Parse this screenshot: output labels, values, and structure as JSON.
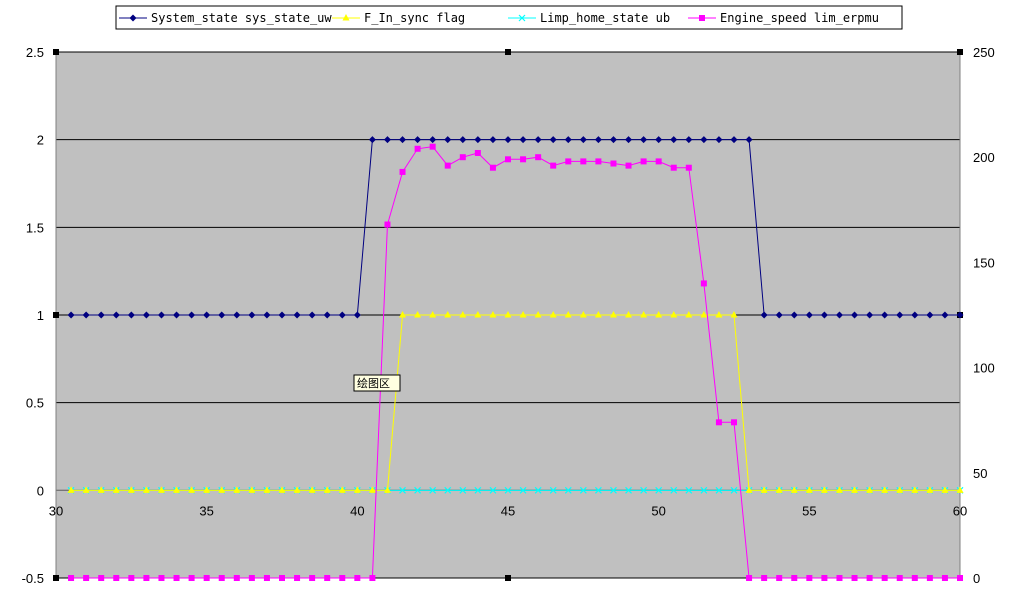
{
  "chart_data": {
    "type": "line",
    "x": [
      30.5,
      31,
      31.5,
      32,
      32.5,
      33,
      33.5,
      34,
      34.5,
      35,
      35.5,
      36,
      36.5,
      37,
      37.5,
      38,
      38.5,
      39,
      39.5,
      40,
      40.5,
      41,
      41.5,
      42,
      42.5,
      43,
      43.5,
      44,
      44.5,
      45,
      45.5,
      46,
      46.5,
      47,
      47.5,
      48,
      48.5,
      49,
      49.5,
      50,
      50.5,
      51,
      51.5,
      52,
      52.5,
      53,
      53.5,
      54,
      54.5,
      55,
      55.5,
      56,
      56.5,
      57,
      57.5,
      58,
      58.5,
      59,
      59.5,
      60
    ],
    "x_range": [
      30,
      60
    ],
    "x_ticks": [
      30,
      35,
      40,
      45,
      50,
      55,
      60
    ],
    "x_tick_labels": [
      "30",
      "35",
      "40",
      "45",
      "50",
      "55",
      "60"
    ],
    "y_left_range": [
      -0.5,
      2.5
    ],
    "y_left_ticks": [
      -0.5,
      0,
      0.5,
      1,
      1.5,
      2,
      2.5
    ],
    "y_left_tick_labels": [
      "-0.5",
      "0",
      "0.5",
      "1",
      "1.5",
      "2",
      "2.5"
    ],
    "y_right_range": [
      0,
      250
    ],
    "y_right_ticks": [
      0,
      50,
      100,
      150,
      200,
      250
    ],
    "y_right_tick_labels": [
      "0",
      "50",
      "100",
      "150",
      "200",
      "250"
    ],
    "gridlines": [
      -0.5,
      0,
      0.5,
      1,
      1.5,
      2,
      2.5
    ],
    "grid": true,
    "legend_position": "top",
    "plot_background": "#c0c0c0",
    "series": [
      {
        "name": "System_state sys_state_uw",
        "color": "#000080",
        "marker": "diamond",
        "axis": "left",
        "values": [
          1,
          1,
          1,
          1,
          1,
          1,
          1,
          1,
          1,
          1,
          1,
          1,
          1,
          1,
          1,
          1,
          1,
          1,
          1,
          1,
          2,
          2,
          2,
          2,
          2,
          2,
          2,
          2,
          2,
          2,
          2,
          2,
          2,
          2,
          2,
          2,
          2,
          2,
          2,
          2,
          2,
          2,
          2,
          2,
          2,
          2,
          1,
          1,
          1,
          1,
          1,
          1,
          1,
          1,
          1,
          1,
          1,
          1,
          1,
          1
        ]
      },
      {
        "name": "F_In_sync flag",
        "color": "#ffff00",
        "marker": "triangle",
        "axis": "left",
        "values": [
          0,
          0,
          0,
          0,
          0,
          0,
          0,
          0,
          0,
          0,
          0,
          0,
          0,
          0,
          0,
          0,
          0,
          0,
          0,
          0,
          0,
          0,
          1,
          1,
          1,
          1,
          1,
          1,
          1,
          1,
          1,
          1,
          1,
          1,
          1,
          1,
          1,
          1,
          1,
          1,
          1,
          1,
          1,
          1,
          1,
          0,
          0,
          0,
          0,
          0,
          0,
          0,
          0,
          0,
          0,
          0,
          0,
          0,
          0,
          0
        ]
      },
      {
        "name": "Limp_home_state ub",
        "color": "#00ffff",
        "marker": "x",
        "axis": "left",
        "values": [
          0,
          0,
          0,
          0,
          0,
          0,
          0,
          0,
          0,
          0,
          0,
          0,
          0,
          0,
          0,
          0,
          0,
          0,
          0,
          0,
          0,
          0,
          0,
          0,
          0,
          0,
          0,
          0,
          0,
          0,
          0,
          0,
          0,
          0,
          0,
          0,
          0,
          0,
          0,
          0,
          0,
          0,
          0,
          0,
          0,
          0,
          0,
          0,
          0,
          0,
          0,
          0,
          0,
          0,
          0,
          0,
          0,
          0,
          0,
          0
        ]
      },
      {
        "name": "Engine_speed lim_erpmu",
        "color": "#ff00ff",
        "marker": "square",
        "axis": "right",
        "values": [
          0,
          0,
          0,
          0,
          0,
          0,
          0,
          0,
          0,
          0,
          0,
          0,
          0,
          0,
          0,
          0,
          0,
          0,
          0,
          0,
          0,
          168,
          193,
          204,
          205,
          196,
          200,
          202,
          195,
          199,
          199,
          200,
          196,
          198,
          198,
          198,
          197,
          196,
          198,
          198,
          195,
          195,
          140,
          74,
          74,
          0,
          0,
          0,
          0,
          0,
          0,
          0,
          0,
          0,
          0,
          0,
          0,
          0,
          0,
          0
        ]
      }
    ]
  },
  "tooltip": {
    "label": "绘图区"
  }
}
